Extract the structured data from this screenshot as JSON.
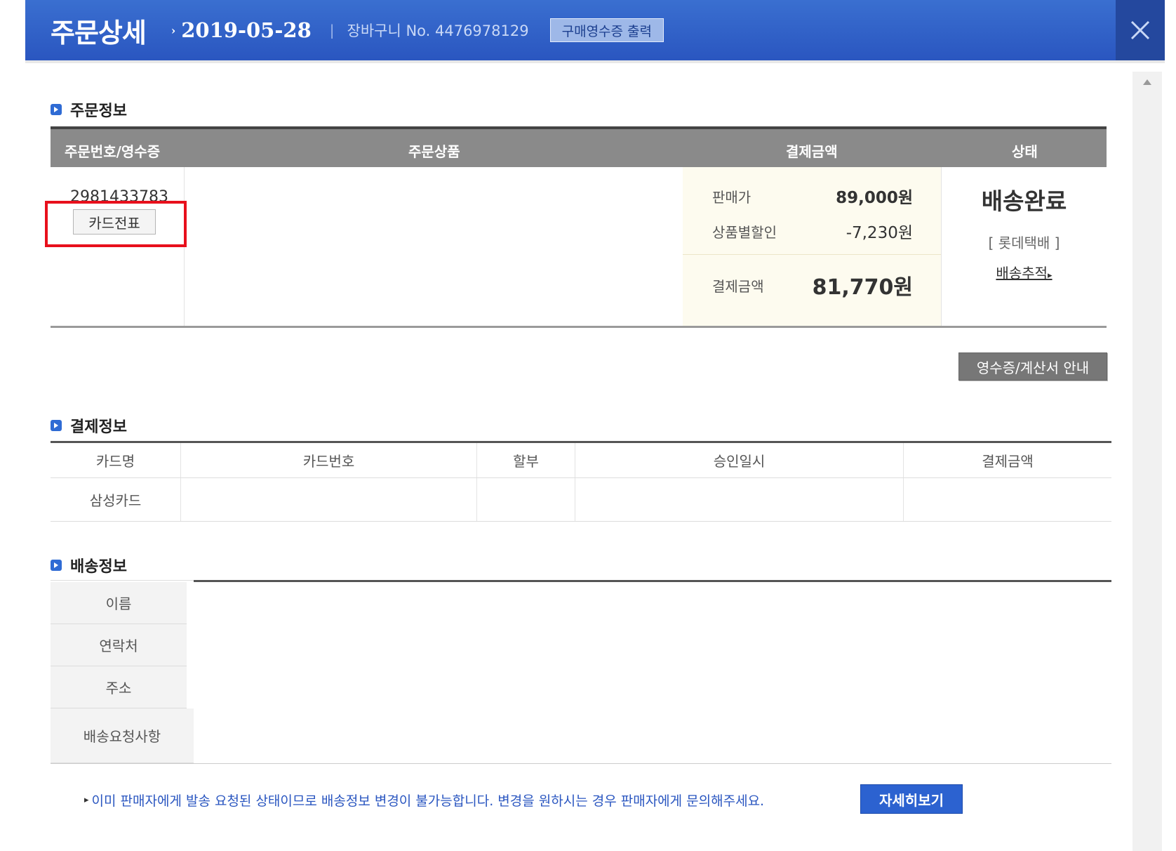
{
  "header": {
    "title": "주문상세",
    "date": "2019-05-28",
    "separator": "|",
    "cart_label": "장바구니 No. 4476978129",
    "receipt_button": "구매영수증 출력",
    "close_icon": "close-icon"
  },
  "order_section": {
    "title": "주문정보",
    "columns": [
      "주문번호/영수증",
      "주문상품",
      "결제금액",
      "상태"
    ],
    "order_number": "2981433783",
    "card_slip_button": "카드전표",
    "price": {
      "sale_label": "판매가",
      "sale_value": "89,000원",
      "discount_label": "상품별할인",
      "discount_value": "-7,230원",
      "total_label": "결제금액",
      "total_value": "81,770원"
    },
    "status": "배송완료",
    "courier": "[ 롯데택배 ]",
    "tracking_link": "배송추적"
  },
  "receipt_guide_button": "영수증/계산서 안내",
  "payment_section": {
    "title": "결제정보",
    "columns": [
      "카드명",
      "카드번호",
      "할부",
      "승인일시",
      "결제금액"
    ],
    "row": [
      "삼성카드",
      "",
      "",
      "",
      ""
    ]
  },
  "delivery_section": {
    "title": "배송정보",
    "labels": [
      "이름",
      "연락처",
      "주소",
      "배송요청사항"
    ]
  },
  "notice": "이미 판매자에게 발송 요청된 상태이므로 배송정보 변경이 불가능합니다. 변경을 원하시는 경우 판매자에게 문의해주세요.",
  "detail_button": "자세히보기",
  "colors": {
    "header_blue": "#2a56c0",
    "highlight_red": "#e8101c",
    "price_bg": "#fdfbef"
  }
}
